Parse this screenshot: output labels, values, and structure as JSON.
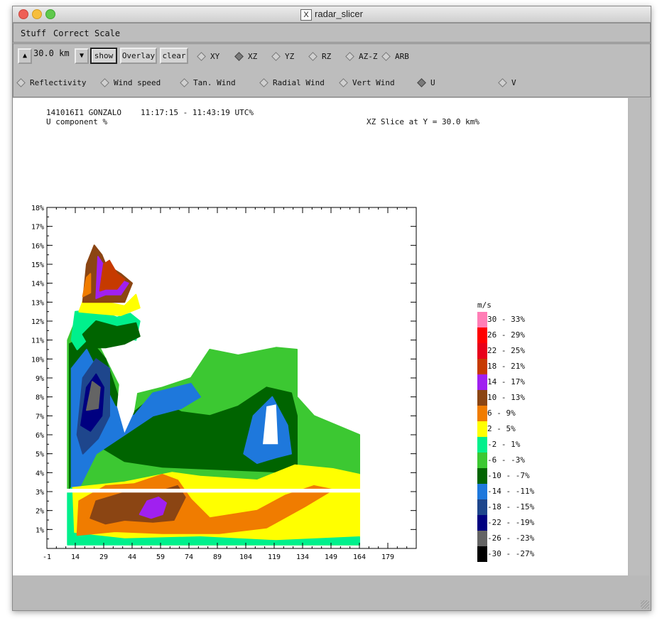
{
  "window": {
    "title": "radar_slicer",
    "x_logo": "X"
  },
  "menu": [
    "Stuff",
    "Correct",
    "Scale"
  ],
  "controls": {
    "range_value": "30.0 km",
    "up_icon": "up-arrow-icon",
    "down_icon": "down-arrow-icon",
    "show_label": "show",
    "overlay_label": "Overlay",
    "clear_label": "clear"
  },
  "slice_modes": [
    {
      "label": "XY",
      "selected": false
    },
    {
      "label": "XZ",
      "selected": true
    },
    {
      "label": "YZ",
      "selected": false
    },
    {
      "label": "RZ",
      "selected": false
    },
    {
      "label": "AZ-Z",
      "selected": false
    },
    {
      "label": "ARB",
      "selected": false
    }
  ],
  "fields": [
    {
      "label": "Reflectivity",
      "selected": false
    },
    {
      "label": "Wind speed",
      "selected": false
    },
    {
      "label": "Tan. Wind",
      "selected": false
    },
    {
      "label": "Radial Wind",
      "selected": false
    },
    {
      "label": "Vert Wind",
      "selected": false
    },
    {
      "label": "U",
      "selected": true
    },
    {
      "label": "V",
      "selected": false
    }
  ],
  "plot_header": {
    "flight": "141016I1 GONZALO",
    "time": "11:17:15 - 11:43:19 UTC%",
    "field": "U component %",
    "slice": "XZ Slice at Y = 30.0 km%"
  },
  "chart_data": {
    "type": "heatmap",
    "y_ticks": [
      "1%",
      "2%",
      "3%",
      "4%",
      "5%",
      "6%",
      "7%",
      "8%",
      "9%",
      "10%",
      "11%",
      "12%",
      "13%",
      "14%",
      "15%",
      "16%",
      "17%",
      "18%"
    ],
    "x_ticks": [
      "-1",
      "14",
      "29",
      "44",
      "59",
      "74",
      "89",
      "104",
      "119",
      "134",
      "149",
      "164",
      "179"
    ],
    "xlim": [
      -1,
      194
    ],
    "ylim": [
      0,
      18
    ],
    "legend_unit": "m/s",
    "legend": [
      {
        "label": "30 - 33%",
        "color": "#ff7eb6"
      },
      {
        "label": "26 - 29%",
        "color": "#ff0000"
      },
      {
        "label": "22 - 25%",
        "color": "#e8001a"
      },
      {
        "label": "18 - 21%",
        "color": "#c63a00"
      },
      {
        "label": "14 - 17%",
        "color": "#a020f0"
      },
      {
        "label": "10 - 13%",
        "color": "#8b4513"
      },
      {
        "label": "6 - 9%",
        "color": "#f07c00"
      },
      {
        "label": "2 - 5%",
        "color": "#ffff00"
      },
      {
        "label": "-2 - 1%",
        "color": "#00f08c"
      },
      {
        "label": "-6 - -3%",
        "color": "#3cc832"
      },
      {
        "label": "-10 - -7%",
        "color": "#006400"
      },
      {
        "label": "-14 - -11%",
        "color": "#1e78dc"
      },
      {
        "label": "-18 - -15%",
        "color": "#1e468c"
      },
      {
        "label": "-22 - -19%",
        "color": "#000080"
      },
      {
        "label": "-26 - -23%",
        "color": "#646464"
      },
      {
        "label": "-30 - -27%",
        "color": "#000000"
      }
    ],
    "regions": [
      {
        "band": "-6 - -3%",
        "color": "#3cc832",
        "points": [
          [
            10,
            3
          ],
          [
            10,
            11
          ],
          [
            14,
            12
          ],
          [
            25,
            11
          ],
          [
            40,
            8
          ],
          [
            60,
            8.5
          ],
          [
            75,
            9
          ],
          [
            85,
            10.5
          ],
          [
            100,
            10.2
          ],
          [
            120,
            10.6
          ],
          [
            131,
            10.5
          ],
          [
            131,
            8
          ],
          [
            140,
            7
          ],
          [
            164,
            6
          ],
          [
            164,
            3
          ]
        ]
      },
      {
        "band": "-10 - -7%",
        "color": "#006400",
        "points": [
          [
            11,
            3
          ],
          [
            11,
            10.8
          ],
          [
            20,
            11.2
          ],
          [
            30,
            10
          ],
          [
            40,
            7
          ],
          [
            45,
            7.2
          ],
          [
            55,
            8
          ],
          [
            70,
            7.2
          ],
          [
            85,
            7
          ],
          [
            100,
            7.5
          ],
          [
            115,
            8.5
          ],
          [
            128,
            8.2
          ],
          [
            131,
            7
          ],
          [
            131,
            4
          ],
          [
            60,
            4.3
          ],
          [
            40,
            4.6
          ],
          [
            25,
            5.5
          ],
          [
            15,
            3
          ]
        ]
      },
      {
        "band": "-14 - -11%",
        "color": "#1e78dc",
        "points": [
          [
            12,
            3
          ],
          [
            12,
            9.5
          ],
          [
            20,
            10.5
          ],
          [
            30,
            8.5
          ],
          [
            35,
            7.5
          ],
          [
            45,
            7
          ],
          [
            55,
            8.2
          ],
          [
            75,
            8.7
          ],
          [
            80,
            8
          ],
          [
            70,
            7.4
          ],
          [
            55,
            7
          ],
          [
            40,
            6
          ],
          [
            25,
            5
          ],
          [
            15,
            3
          ]
        ]
      },
      {
        "band": "-14 - -11% aloft",
        "color": "#1e78dc",
        "points": [
          [
            103,
            5
          ],
          [
            108,
            7
          ],
          [
            118,
            8
          ],
          [
            126,
            6.5
          ],
          [
            128,
            5
          ],
          [
            120,
            4.8
          ],
          [
            110,
            4.5
          ]
        ]
      },
      {
        "band": "-18 - -15%",
        "color": "#1e468c",
        "points": [
          [
            15,
            6
          ],
          [
            18,
            9
          ],
          [
            25,
            10
          ],
          [
            32,
            9.5
          ],
          [
            32,
            7
          ],
          [
            26,
            5.8
          ],
          [
            18,
            5
          ]
        ]
      },
      {
        "band": "-22 - -19%",
        "color": "#000080",
        "points": [
          [
            17,
            6.5
          ],
          [
            20,
            8.5
          ],
          [
            25,
            9.2
          ],
          [
            29,
            8.5
          ],
          [
            28,
            7
          ],
          [
            22,
            6.2
          ]
        ]
      },
      {
        "band": "-26 - -23%",
        "color": "#646464",
        "points": [
          [
            20,
            7.3
          ],
          [
            23,
            8.8
          ],
          [
            27,
            8.5
          ],
          [
            26,
            7.4
          ]
        ]
      },
      {
        "band": "-2 - 1%",
        "color": "#00f08c",
        "points": [
          [
            12,
            11
          ],
          [
            14,
            12.5
          ],
          [
            24,
            12.6
          ],
          [
            36,
            12.2
          ],
          [
            43,
            12.4
          ],
          [
            48,
            12
          ],
          [
            46,
            11
          ],
          [
            35,
            11.3
          ],
          [
            25,
            11.5
          ],
          [
            15,
            10.5
          ]
        ]
      },
      {
        "band": "-10 - -7% cap",
        "color": "#006400",
        "points": [
          [
            18,
            11.3
          ],
          [
            25,
            12
          ],
          [
            36,
            11.7
          ],
          [
            46,
            11.9
          ],
          [
            48,
            11.2
          ],
          [
            40,
            10.8
          ],
          [
            30,
            10.6
          ],
          [
            22,
            10.6
          ]
        ]
      },
      {
        "band": "2 - 5% aloft",
        "color": "#ffff00",
        "points": [
          [
            16,
            12.5
          ],
          [
            19,
            13.3
          ],
          [
            30,
            13
          ],
          [
            40,
            12.8
          ],
          [
            46,
            13.4
          ],
          [
            48,
            12.7
          ],
          [
            38,
            12.3
          ],
          [
            26,
            12.4
          ]
        ]
      },
      {
        "band": "10 - 13% aloft",
        "color": "#8b4513",
        "points": [
          [
            18,
            13
          ],
          [
            20,
            15
          ],
          [
            24,
            16
          ],
          [
            28,
            15.5
          ],
          [
            30,
            15
          ],
          [
            38,
            14.5
          ],
          [
            44,
            14
          ],
          [
            40,
            13
          ],
          [
            30,
            13
          ],
          [
            22,
            13
          ]
        ]
      },
      {
        "band": "14 - 17% aloft",
        "color": "#a020f0",
        "points": [
          [
            25,
            13.2
          ],
          [
            26,
            15.4
          ],
          [
            30,
            14.8
          ],
          [
            37,
            14.2
          ],
          [
            42,
            14
          ],
          [
            38,
            13.4
          ],
          [
            30,
            13.4
          ]
        ]
      },
      {
        "band": "18 - 21% aloft",
        "color": "#c63a00",
        "points": [
          [
            27,
            13.6
          ],
          [
            29,
            15
          ],
          [
            32,
            15.2
          ],
          [
            36,
            14.5
          ],
          [
            40,
            14.2
          ],
          [
            36,
            13.7
          ],
          [
            30,
            13.7
          ]
        ]
      },
      {
        "band": "6 - 9% aloft",
        "color": "#f07c00",
        "points": [
          [
            18,
            13.3
          ],
          [
            20,
            14.3
          ],
          [
            22,
            14.5
          ],
          [
            22,
            13.5
          ]
        ]
      },
      {
        "band": "2 - 5% low",
        "color": "#ffff00",
        "points": [
          [
            12,
            0.5
          ],
          [
            12,
            3.2
          ],
          [
            40,
            3.5
          ],
          [
            65,
            4
          ],
          [
            80,
            3.8
          ],
          [
            110,
            3.6
          ],
          [
            130,
            4.4
          ],
          [
            150,
            4.2
          ],
          [
            164,
            3.9
          ],
          [
            164,
            0.2
          ],
          [
            100,
            0.2
          ],
          [
            40,
            0.2
          ]
        ]
      },
      {
        "band": "-2 - 1% low",
        "color": "#00f08c",
        "points": [
          [
            10,
            0.2
          ],
          [
            10,
            3
          ],
          [
            12,
            3.2
          ],
          [
            13,
            0.8
          ],
          [
            40,
            0.5
          ],
          [
            80,
            0.6
          ],
          [
            120,
            0.4
          ],
          [
            164,
            0.6
          ],
          [
            164,
            0.2
          ]
        ]
      },
      {
        "band": "6 - 9% low",
        "color": "#f07c00",
        "points": [
          [
            15,
            0.7
          ],
          [
            16,
            2.5
          ],
          [
            30,
            3.3
          ],
          [
            45,
            3.4
          ],
          [
            60,
            3.9
          ],
          [
            68,
            3.6
          ],
          [
            75,
            2.6
          ],
          [
            85,
            1.6
          ],
          [
            110,
            2
          ],
          [
            125,
            2.8
          ],
          [
            140,
            3.3
          ],
          [
            150,
            3.1
          ],
          [
            135,
            2.2
          ],
          [
            115,
            1.1
          ],
          [
            90,
            0.8
          ],
          [
            60,
            0.8
          ],
          [
            35,
            0.9
          ]
        ]
      },
      {
        "band": "10 - 13% low",
        "color": "#8b4513",
        "points": [
          [
            22,
            1.6
          ],
          [
            25,
            2.5
          ],
          [
            35,
            2.8
          ],
          [
            45,
            3.1
          ],
          [
            58,
            3
          ],
          [
            68,
            3.3
          ],
          [
            72,
            2.7
          ],
          [
            66,
            1.5
          ],
          [
            55,
            1.4
          ],
          [
            40,
            1.5
          ],
          [
            30,
            1.3
          ]
        ]
      },
      {
        "band": "14 - 17% low",
        "color": "#a020f0",
        "points": [
          [
            48,
            1.8
          ],
          [
            52,
            2.5
          ],
          [
            58,
            2.7
          ],
          [
            62,
            2.4
          ],
          [
            60,
            1.8
          ],
          [
            54,
            1.6
          ]
        ]
      }
    ],
    "gaps": [
      {
        "name": "data gap near 3 km",
        "y_range": [
          2.95,
          3.15
        ]
      },
      {
        "name": "unsampled core",
        "points": [
          [
            40,
            6.1
          ],
          [
            36,
            7.5
          ],
          [
            38,
            9.5
          ],
          [
            46,
            10.8
          ],
          [
            48,
            9
          ],
          [
            45,
            7.2
          ]
        ]
      },
      {
        "name": "unsampled notch",
        "points": [
          [
            113,
            5.5
          ],
          [
            115,
            7.5
          ],
          [
            120,
            7.6
          ],
          [
            121,
            5.5
          ]
        ]
      }
    ]
  }
}
